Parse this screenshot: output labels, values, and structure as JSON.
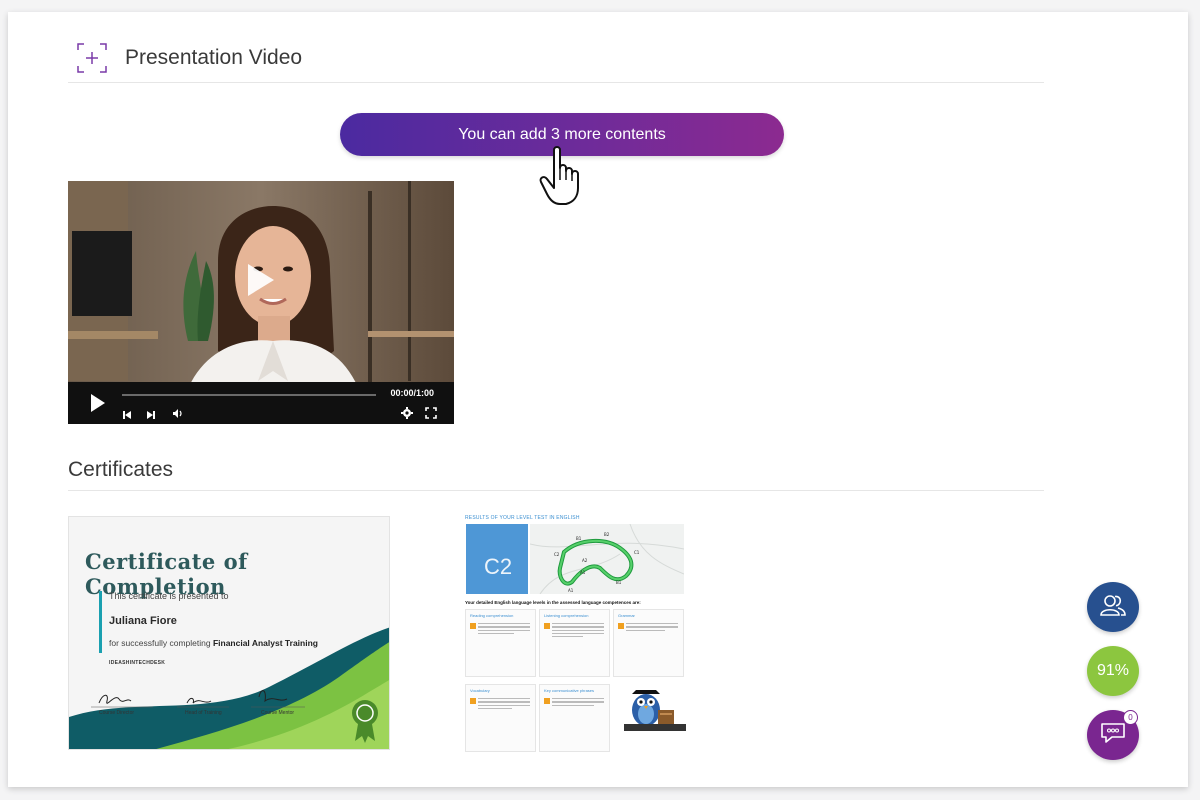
{
  "presentation": {
    "title": "Presentation Video",
    "add_button_label": "You can add 3 more contents",
    "video": {
      "time": "00:00/1:00",
      "progress": 0
    }
  },
  "certificates": {
    "title": "Certificates",
    "certificate": {
      "heading": "Certificate of Completion",
      "presented_to": "This certificate is presented to",
      "recipient": "Juliana Fiore",
      "completing_prefix": "for successfully completing",
      "course": "Financial Analyst Training",
      "brand": "IDEASHINTECHDESK",
      "signatures": [
        "Course Director",
        "Head of Training",
        "Course Mentor"
      ]
    },
    "report": {
      "title": "RESULTS OF YOUR LEVEL TEST IN ENGLISH",
      "level": "C2",
      "map_levels": [
        "B1",
        "B2",
        "C1",
        "C2",
        "A2",
        "A1",
        "B1",
        "A1"
      ],
      "subtitle": "Your detailed English language levels in the assessed language competences are:",
      "competences": [
        "Reading comprehension",
        "Listening comprehension",
        "Grammar",
        "Vocabulary",
        "Key communicative phrases"
      ]
    }
  },
  "fabs": {
    "score": "91%",
    "chat_badge": "0"
  },
  "colors": {
    "pill_start": "#4b2aa0",
    "pill_end": "#8c2a90",
    "users_fab": "#27508f",
    "score_fab": "#8cc63f",
    "chat_fab": "#7a2690",
    "cert_heading": "#2e5a5c"
  },
  "icons": {
    "section_icon": "add-frame-icon",
    "cursor": "hand-pointer-icon",
    "play": "play-icon",
    "users": "users-icon",
    "chat": "chat-icon"
  }
}
